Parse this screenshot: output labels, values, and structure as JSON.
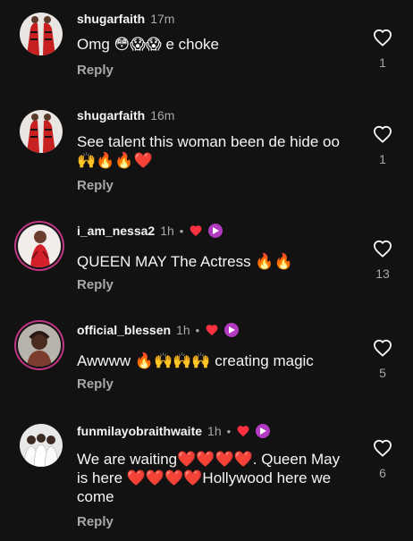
{
  "comments": [
    {
      "username": "shugarfaith",
      "time": "17m",
      "text": "Omg 😳😱😱 e choke",
      "reply": "Reply",
      "likes": "1",
      "avatar": "avatar-red-dress",
      "badges": false
    },
    {
      "username": "shugarfaith",
      "time": "16m",
      "text": "See talent this woman been de hide oo🙌🔥🔥❤️",
      "reply": "Reply",
      "likes": "1",
      "avatar": "avatar-red-dress",
      "badges": false
    },
    {
      "username": "i_am_nessa2",
      "time": "1h",
      "text": "QUEEN MAY The Actress 🔥🔥",
      "reply": "Reply",
      "likes": "13",
      "avatar": "avatar-red-outfit",
      "badges": true
    },
    {
      "username": "official_blessen",
      "time": "1h",
      "text": "Awwww 🔥🙌🙌🙌 creating magic",
      "reply": "Reply",
      "likes": "5",
      "avatar": "avatar-portrait",
      "badges": true
    },
    {
      "username": "funmilayobraithwaite",
      "time": "1h",
      "text": "We are waiting❤️❤️❤️❤️. Queen May is here ❤️❤️❤️❤️Hollywood here we come",
      "reply": "Reply",
      "likes": "6",
      "avatar": "avatar-group",
      "badges": true
    }
  ],
  "colors": {
    "background": "#121212",
    "secondary_text": "#a8a8a8",
    "author_heart": "#ff3040",
    "creator_badge": "#b23ac0",
    "story_ring": "#c13584"
  },
  "icons": {
    "like": "heart-outline-icon",
    "author_liked": "red-heart-icon",
    "creator": "play-badge-icon"
  },
  "separator": "•"
}
